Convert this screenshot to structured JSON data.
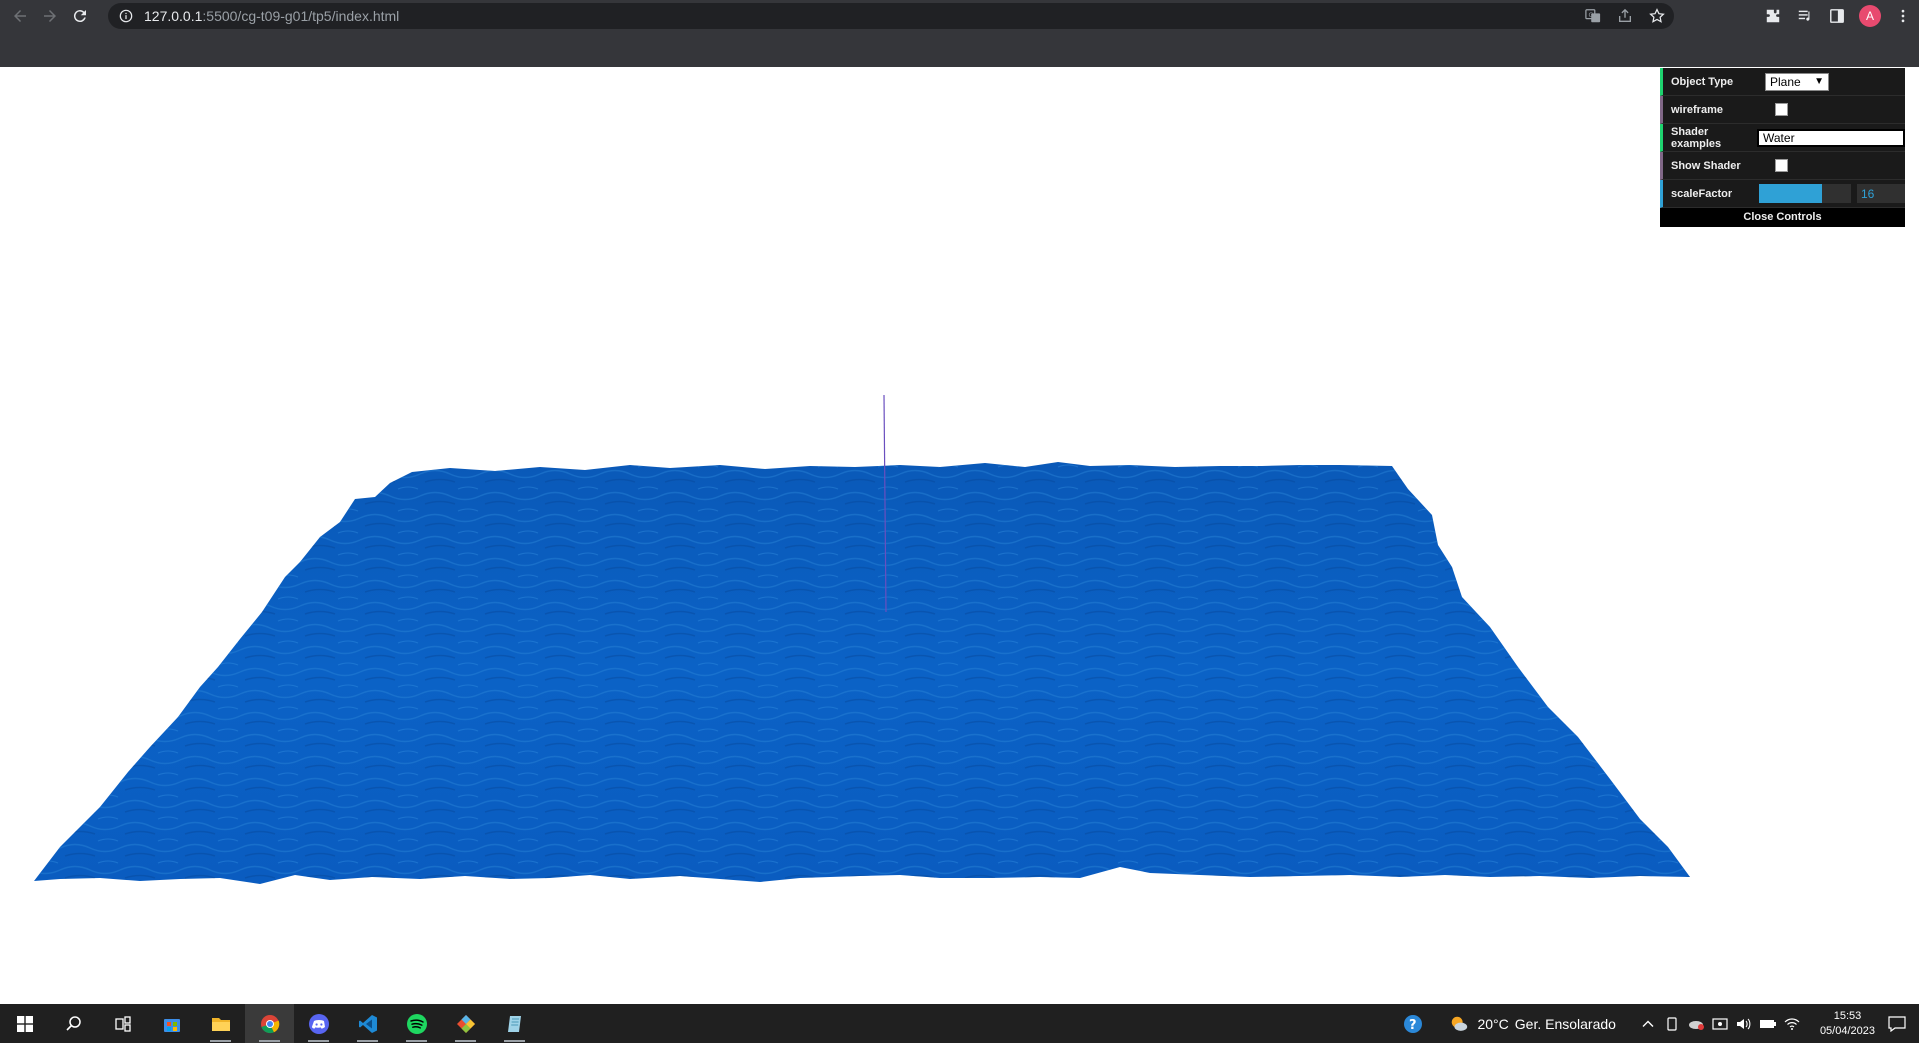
{
  "browser": {
    "url_host": "127.0.0.1",
    "url_rest": ":5500/cg-t09-g01/tp5/index.html",
    "avatar_letter": "A",
    "icons": [
      "back-arrow-icon",
      "forward-arrow-icon",
      "reload-icon",
      "site-info-icon",
      "translate-icon",
      "share-icon",
      "bookmark-star-icon",
      "extensions-icon",
      "reading-list-icon",
      "side-panel-icon",
      "menu-icon"
    ]
  },
  "gui": {
    "object_type": {
      "label": "Object Type",
      "value": "Plane"
    },
    "wireframe": {
      "label": "wireframe",
      "checked": false
    },
    "shader_examples": {
      "label": "Shader examples",
      "value": "Water"
    },
    "show_shader": {
      "label": "Show Shader",
      "checked": false
    },
    "scale_factor": {
      "label": "scaleFactor",
      "value": "16",
      "fraction": 0.68
    },
    "close_label": "Close Controls",
    "colors": {
      "number": "#2fa1d6",
      "boolean": "#806787",
      "string": "#1ed36f",
      "background": "#1a1a1a"
    }
  },
  "scene": {
    "plane_color": "#0a5fc0",
    "axis_color": "#6a4fbf"
  },
  "taskbar": {
    "apps": [
      "windows-start-icon",
      "search-icon",
      "task-view-icon",
      "microsoft-store-icon",
      "file-explorer-icon",
      "chrome-icon",
      "discord-icon",
      "vscode-icon",
      "spotify-icon",
      "git-icon",
      "notepad-icon"
    ],
    "weather_temp": "20°C",
    "weather_text": "Ger. Ensolarado",
    "time": "15:53",
    "date": "05/04/2023"
  }
}
